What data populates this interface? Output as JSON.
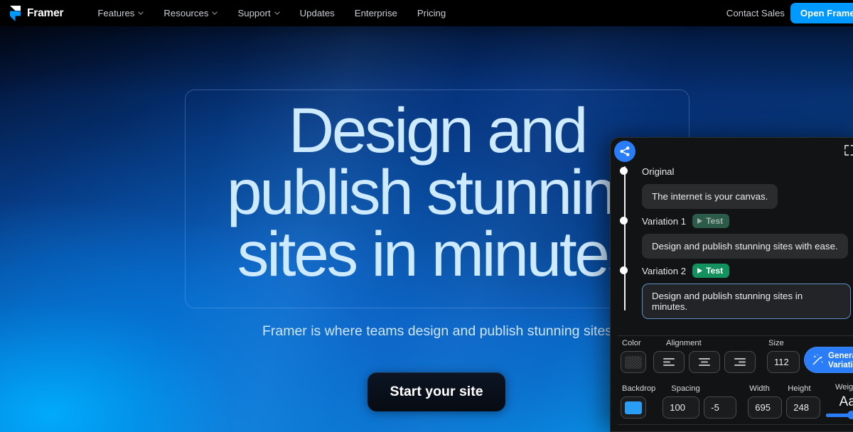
{
  "navbar": {
    "brand": "Framer",
    "logo_icon": "framer-logo-icon",
    "links": [
      {
        "label": "Features",
        "has_chevron": true
      },
      {
        "label": "Resources",
        "has_chevron": true
      },
      {
        "label": "Support",
        "has_chevron": true
      },
      {
        "label": "Updates",
        "has_chevron": false
      },
      {
        "label": "Enterprise",
        "has_chevron": false
      },
      {
        "label": "Pricing",
        "has_chevron": false
      }
    ],
    "contact_sales": "Contact Sales",
    "open_framer": "Open Framer",
    "accent_color": "#0099ff"
  },
  "hero": {
    "heading_line1": "Design and",
    "heading_line2": "publish stunning",
    "heading_line3": "sites in minutes",
    "subheading": "Framer is where teams design and publish stunning sites",
    "cta_label": "Start your site",
    "heading_color": "#ceeaff"
  },
  "panel": {
    "share_icon": "share-icon",
    "expand_icon": "expand-icon",
    "variations": [
      {
        "label": "Original",
        "text": "The internet is your canvas.",
        "has_test": false,
        "test_label": "",
        "selected": false
      },
      {
        "label": "Variation 1",
        "text": "Design and publish stunning sites with ease.",
        "has_test": true,
        "test_label": "Test",
        "selected": false
      },
      {
        "label": "Variation 2",
        "text": "Design and publish stunning sites in minutes.",
        "has_test": true,
        "test_label": "Test",
        "selected": true
      }
    ],
    "controls": {
      "color_label": "Color",
      "alignment_label": "Alignment",
      "size_label": "Size",
      "size_value": "112",
      "generate_line1": "Generate",
      "generate_line2": "Variation",
      "generate_icon": "magic-wand-icon",
      "backdrop_label": "Backdrop",
      "backdrop_color": "#2a9df4",
      "spacing_label": "Spacing",
      "spacing_value": "100",
      "spacing_value2": "-5",
      "width_label": "Width",
      "width_value": "695",
      "height_label": "Height",
      "height_value": "248",
      "weight_label": "Weight",
      "weight_sample": "Aa",
      "weight_percent": "60"
    }
  }
}
